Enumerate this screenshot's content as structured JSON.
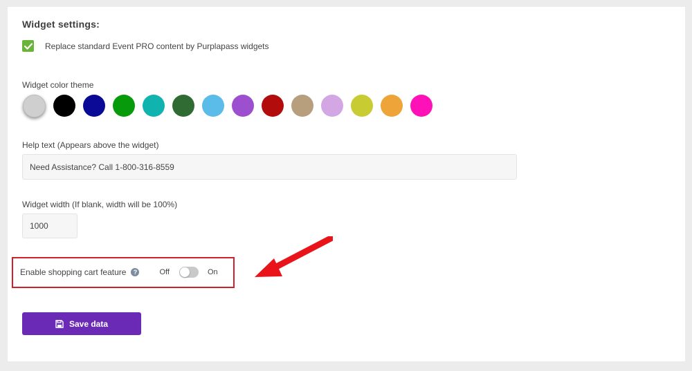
{
  "widget_settings": {
    "title": "Widget settings:",
    "replace_checkbox": {
      "checked": true,
      "label": "Replace standard Event PRO content by Purplapass widgets"
    }
  },
  "color_theme": {
    "label": "Widget color theme",
    "swatches": [
      "#cfcfcf",
      "#000000",
      "#0b0a96",
      "#079a0b",
      "#10b3ad",
      "#2f6b33",
      "#5bbbe9",
      "#9c4fce",
      "#b20c0c",
      "#b79f7e",
      "#d3a6e4",
      "#c9cb33",
      "#efa43a",
      "#ff11b8"
    ],
    "selected_index": 0
  },
  "help_text": {
    "label": "Help text (Appears above the widget)",
    "value": "Need Assistance? Call 1-800-316-8559"
  },
  "widget_width": {
    "label": "Widget width (If blank, width will be 100%)",
    "value": "1000"
  },
  "shopping_cart": {
    "label": "Enable shopping cart feature",
    "help_icon": "question-circle-icon",
    "off_label": "Off",
    "on_label": "On",
    "enabled": false
  },
  "save_button": {
    "label": "Save data",
    "icon": "save-icon",
    "color": "#6b2ab6"
  },
  "annotation": {
    "highlight_color": "#d11f2b",
    "arrow_color": "#e8141a"
  }
}
